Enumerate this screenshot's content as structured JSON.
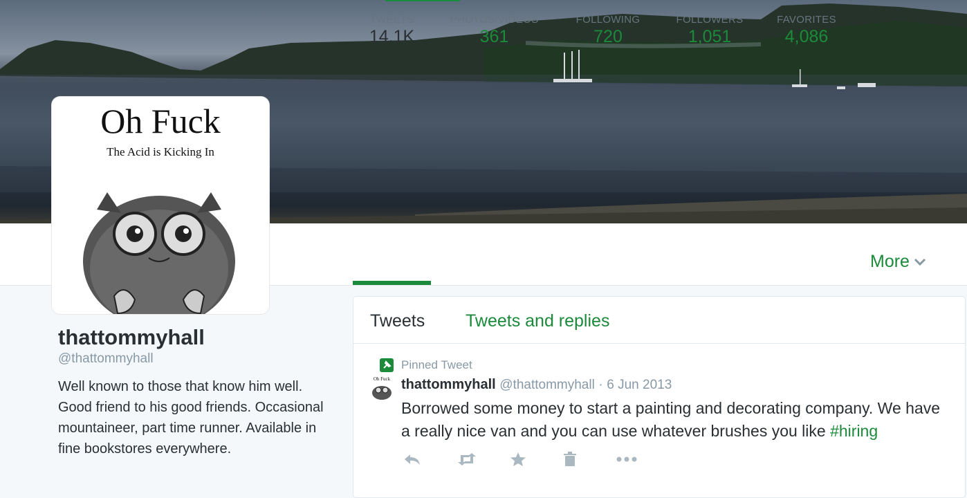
{
  "profile": {
    "name": "thattommyhall",
    "handle": "@thattommyhall",
    "bio": "Well known to those that know him well. Good friend to his good friends. Occasional mountaineer, part time runner. Available in fine bookstores everywhere.",
    "avatar": {
      "title": "Oh Fuck",
      "subtitle": "The Acid is Kicking In"
    }
  },
  "stats": [
    {
      "label": "TWEETS",
      "value": "14.1K"
    },
    {
      "label": "PHOTOS/VIDEOS",
      "value": "361"
    },
    {
      "label": "FOLLOWING",
      "value": "720"
    },
    {
      "label": "FOLLOWERS",
      "value": "1,051"
    },
    {
      "label": "FAVORITES",
      "value": "4,086"
    }
  ],
  "nav": {
    "more_label": "More"
  },
  "timeline": {
    "tabs": [
      "Tweets",
      "Tweets and replies"
    ],
    "pinned_label": "Pinned Tweet",
    "tweet": {
      "avatar_title": "Oh Fuck",
      "author": "thattommyhall",
      "handle": "@thattommyhall",
      "separator": "·",
      "date": "6 Jun 2013",
      "text": "Borrowed some money to start a painting and decorating company. We have a really nice van and you can use whatever brushes you like ",
      "hashtag": "#hiring"
    },
    "actions": [
      "reply-icon",
      "retweet-icon",
      "favorite-icon",
      "delete-icon",
      "more-icon"
    ]
  },
  "colors": {
    "accent": "#1b8a3a",
    "text": "#292f33",
    "muted": "#8899a6",
    "background": "#f5f8fa"
  }
}
